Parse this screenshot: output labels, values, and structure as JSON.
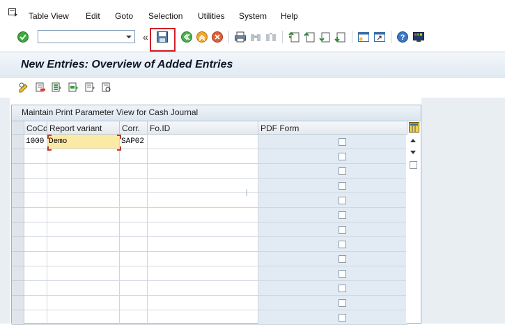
{
  "menu": [
    "Table View",
    "Edit",
    "Goto",
    "Selection",
    "Utilities",
    "System",
    "Help"
  ],
  "toolbar": {
    "command_field": "",
    "icons": [
      "enter-icon",
      "save-icon",
      "back-icon",
      "exit-icon",
      "cancel-icon",
      "print-icon",
      "find-icon",
      "find-next-icon",
      "first-page-icon",
      "previous-page-icon",
      "next-page-icon",
      "last-page-icon",
      "new-session-icon",
      "shortcut-icon",
      "help-icon",
      "customize-layout-icon"
    ]
  },
  "title": "New Entries: Overview of Added Entries",
  "app_toolbar_icons": [
    "change-display-icon",
    "delete-icon",
    "select-all-icon",
    "select-block-icon",
    "deselect-all-icon",
    "variant-icon"
  ],
  "table": {
    "title": "Maintain Print Parameter View for Cash Journal",
    "columns": [
      "CoCd",
      "Report variant",
      "Corr.",
      "Fo.ID",
      "PDF Form"
    ],
    "rows": [
      {
        "cocd": "1000",
        "variant": "Demo",
        "corr": "SAP02",
        "foid": "",
        "pdf": false
      },
      {
        "cocd": "",
        "variant": "",
        "corr": "",
        "foid": "",
        "pdf": false
      },
      {
        "cocd": "",
        "variant": "",
        "corr": "",
        "foid": "",
        "pdf": false
      },
      {
        "cocd": "",
        "variant": "",
        "corr": "",
        "foid": "",
        "pdf": false
      },
      {
        "cocd": "",
        "variant": "",
        "corr": "",
        "foid": "",
        "pdf": false
      },
      {
        "cocd": "",
        "variant": "",
        "corr": "",
        "foid": "",
        "pdf": false
      },
      {
        "cocd": "",
        "variant": "",
        "corr": "",
        "foid": "",
        "pdf": false
      },
      {
        "cocd": "",
        "variant": "",
        "corr": "",
        "foid": "",
        "pdf": false
      },
      {
        "cocd": "",
        "variant": "",
        "corr": "",
        "foid": "",
        "pdf": false
      },
      {
        "cocd": "",
        "variant": "",
        "corr": "",
        "foid": "",
        "pdf": false
      },
      {
        "cocd": "",
        "variant": "",
        "corr": "",
        "foid": "",
        "pdf": false
      },
      {
        "cocd": "",
        "variant": "",
        "corr": "",
        "foid": "",
        "pdf": false
      },
      {
        "cocd": "",
        "variant": "",
        "corr": "",
        "foid": "",
        "pdf": false
      }
    ]
  },
  "colors": {
    "accent_blue": "#dfe8f1",
    "highlight_red": "#d21f26",
    "edit_yellow": "#fbe9a6"
  }
}
